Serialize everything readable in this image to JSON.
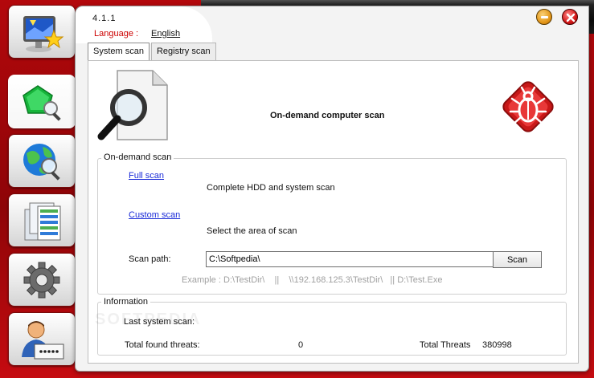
{
  "app": {
    "version": "4.1.1",
    "language_label": "Language :",
    "language_value": "English"
  },
  "tabs": [
    {
      "label": "System scan",
      "active": true
    },
    {
      "label": "Registry scan",
      "active": false
    }
  ],
  "header": {
    "title": "On-demand computer scan"
  },
  "ondemand": {
    "legend": "On-demand scan",
    "full_scan_link": "Full scan",
    "full_scan_desc": "Complete HDD and system scan",
    "custom_scan_link": "Custom scan",
    "custom_scan_desc": "Select the area of scan",
    "scan_path_label": "Scan path:",
    "scan_path_value": "C:\\Softpedia\\",
    "scan_button": "Scan",
    "example": "Example : D:\\TestDir\\    ||    \\\\192.168.125.3\\TestDir\\   || D:\\Test.Exe"
  },
  "information": {
    "legend": "Information",
    "last_scan_label": "Last system scan:",
    "found_threats_label": "Total found threats:",
    "found_threats_value": "0",
    "total_threats_label": "Total Threats",
    "total_threats_value": "380998"
  },
  "watermark": "SOFTPEDIA",
  "nav": [
    {
      "name": "nav-home",
      "icon": "monitor-star-icon"
    },
    {
      "name": "nav-scan",
      "icon": "shield-magnifier-icon",
      "active": true
    },
    {
      "name": "nav-web-scan",
      "icon": "globe-magnifier-icon"
    },
    {
      "name": "nav-quarantine",
      "icon": "server-rack-icon"
    },
    {
      "name": "nav-settings",
      "icon": "gear-icon"
    },
    {
      "name": "nav-account",
      "icon": "user-password-icon"
    }
  ],
  "colors": {
    "background": "#a8070b",
    "link": "#1a2bd8",
    "language_label": "#cc0000",
    "example": "#a0a0a0"
  }
}
